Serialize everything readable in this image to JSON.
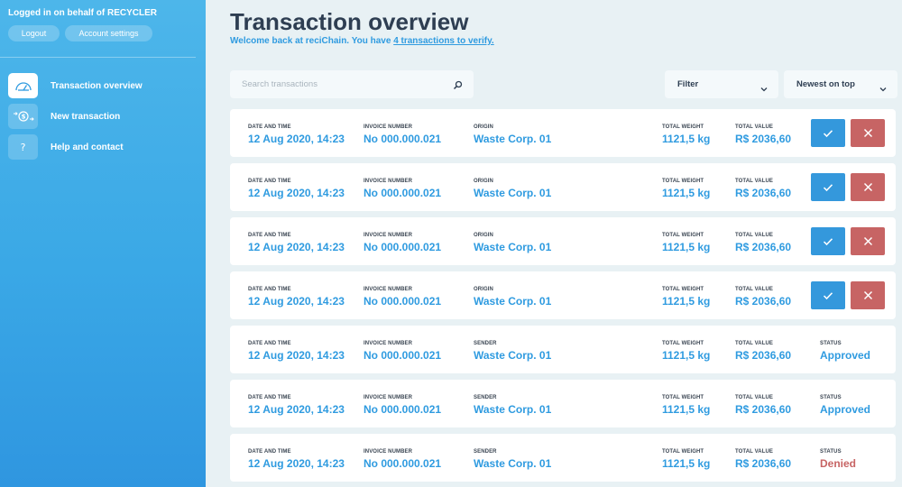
{
  "sidebar": {
    "logged_in": "Logged in on behalf of RECYCLER",
    "logout": "Logout",
    "account_settings": "Account settings",
    "items": [
      {
        "label": "Transaction overview",
        "icon": "gauge-icon",
        "active": true
      },
      {
        "label": "New transaction",
        "icon": "coins-transfer-icon",
        "active": false
      },
      {
        "label": "Help and contact",
        "icon": "question-icon",
        "active": false
      }
    ]
  },
  "main": {
    "title": "Transaction overview",
    "welcome_prefix": "Welcome back at reciChain. You have ",
    "welcome_link": "4 transactions to verify.",
    "search_placeholder": "Search transactions",
    "filter_label": "Filter",
    "sort_label": "Newest on top"
  },
  "labels": {
    "date": "DATE AND TIME",
    "invoice": "INVOICE NUMBER",
    "origin": "ORIGIN",
    "sender": "SENDER",
    "weight": "TOTAL WEIGHT",
    "value": "TOTAL VALUE",
    "status": "STATUS"
  },
  "transactions": [
    {
      "date": "12 Aug 2020, 14:23",
      "invoice": "No 000.000.021",
      "party_label": "ORIGIN",
      "party": "Waste Corp. 01",
      "weight": "1121,5 kg",
      "value": "R$ 2036,60",
      "pending": true
    },
    {
      "date": "12 Aug 2020, 14:23",
      "invoice": "No 000.000.021",
      "party_label": "ORIGIN",
      "party": "Waste Corp. 01",
      "weight": "1121,5 kg",
      "value": "R$ 2036,60",
      "pending": true
    },
    {
      "date": "12 Aug 2020, 14:23",
      "invoice": "No 000.000.021",
      "party_label": "ORIGIN",
      "party": "Waste Corp. 01",
      "weight": "1121,5 kg",
      "value": "R$ 2036,60",
      "pending": true
    },
    {
      "date": "12 Aug 2020, 14:23",
      "invoice": "No 000.000.021",
      "party_label": "ORIGIN",
      "party": "Waste Corp. 01",
      "weight": "1121,5 kg",
      "value": "R$ 2036,60",
      "pending": true
    },
    {
      "date": "12 Aug 2020, 14:23",
      "invoice": "No 000.000.021",
      "party_label": "SENDER",
      "party": "Waste Corp. 01",
      "weight": "1121,5 kg",
      "value": "R$ 2036,60",
      "pending": false,
      "status": "Approved"
    },
    {
      "date": "12 Aug 2020, 14:23",
      "invoice": "No 000.000.021",
      "party_label": "SENDER",
      "party": "Waste Corp. 01",
      "weight": "1121,5 kg",
      "value": "R$ 2036,60",
      "pending": false,
      "status": "Approved"
    },
    {
      "date": "12 Aug 2020, 14:23",
      "invoice": "No 000.000.021",
      "party_label": "SENDER",
      "party": "Waste Corp. 01",
      "weight": "1121,5 kg",
      "value": "R$ 2036,60",
      "pending": false,
      "status": "Denied"
    }
  ],
  "colors": {
    "accent": "#2f9be0",
    "approve": "#3498dc",
    "deny": "#c76464",
    "title": "#2e3e52"
  }
}
